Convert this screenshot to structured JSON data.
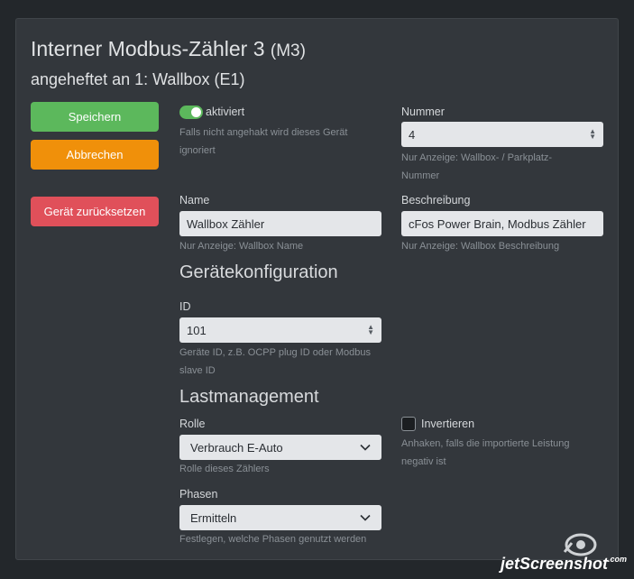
{
  "header": {
    "title": "Interner Modbus-Zähler 3",
    "title_tag": "(M3)",
    "subtitle": "angeheftet an 1: Wallbox (E1)"
  },
  "actions": {
    "save_label": "Speichern",
    "cancel_label": "Abbrechen",
    "reset_label": "Gerät zurücksetzen"
  },
  "activation": {
    "label": "aktiviert",
    "enabled": true,
    "hint": "Falls nicht angehakt wird dieses Gerät ignoriert"
  },
  "nummer": {
    "label": "Nummer",
    "value": "4",
    "hint": "Nur Anzeige: Wallbox- / Parkplatz-Nummer"
  },
  "name": {
    "label": "Name",
    "value": "Wallbox Zähler",
    "hint": "Nur Anzeige: Wallbox Name"
  },
  "beschreibung": {
    "label": "Beschreibung",
    "value": "cFos Power Brain, Modbus Zähler",
    "hint": "Nur Anzeige: Wallbox Beschreibung"
  },
  "geraetekonfiguration": {
    "heading": "Gerätekonfiguration",
    "id_label": "ID",
    "id_value": "101",
    "id_hint": "Geräte ID, z.B. OCPP plug ID oder Modbus slave ID"
  },
  "lastmanagement": {
    "heading": "Lastmanagement",
    "rolle_label": "Rolle",
    "rolle_value": "Verbrauch E-Auto",
    "rolle_hint": "Rolle dieses Zählers",
    "invertieren_label": "Invertieren",
    "invertieren_checked": false,
    "invertieren_hint": "Anhaken, falls die importierte Leistung negativ ist",
    "phasen_label": "Phasen",
    "phasen_value": "Ermitteln",
    "phasen_hint": "Festlegen, welche Phasen genutzt werden"
  },
  "watermark": {
    "text": "jetScreenshot",
    "suffix": ".com"
  },
  "colors": {
    "background": "#23272b",
    "panel": "#33373c",
    "save": "#5cb85c",
    "cancel": "#f0900a",
    "reset": "#e0505a",
    "input": "#e4e6e9"
  }
}
